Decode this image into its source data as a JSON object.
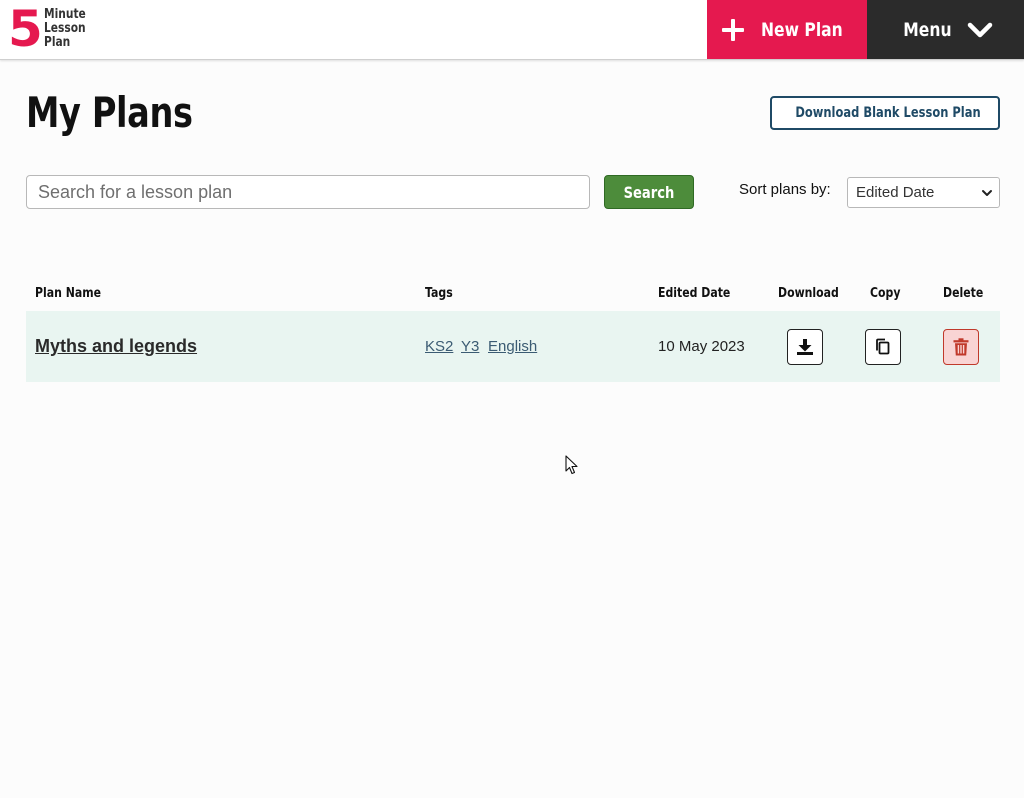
{
  "header": {
    "logo": {
      "number": "5",
      "words": [
        "Minute",
        "Lesson",
        "Plan"
      ]
    },
    "new_plan_label": "New Plan",
    "menu_label": "Menu"
  },
  "page": {
    "title": "My Plans",
    "download_blank_label": "Download Blank Lesson Plan"
  },
  "search": {
    "placeholder": "Search for a lesson plan",
    "button_label": "Search",
    "sort_label": "Sort plans by:",
    "sort_selected": "Edited Date"
  },
  "table": {
    "headers": {
      "plan_name": "Plan Name",
      "tags": "Tags",
      "edited_date": "Edited Date",
      "download": "Download",
      "copy": "Copy",
      "delete": "Delete"
    },
    "rows": [
      {
        "name": "Myths and legends",
        "tags": [
          "KS2",
          "Y3",
          "English"
        ],
        "edited_date": "10 May 2023"
      }
    ]
  },
  "colors": {
    "brand": "#e5194f",
    "dark": "#2b2b2b",
    "search_green": "#4d8c3b",
    "row_bg": "#e9f5f1",
    "delete_bg": "#f9d4d4",
    "delete_icon": "#c0392b",
    "outline_blue": "#1f4a66"
  },
  "icons": {
    "new_plan": "plus-icon",
    "menu": "chevron-down-icon",
    "download_blank": "download-icon",
    "row_download": "download-icon",
    "row_copy": "copy-icon",
    "row_delete": "trash-icon"
  }
}
